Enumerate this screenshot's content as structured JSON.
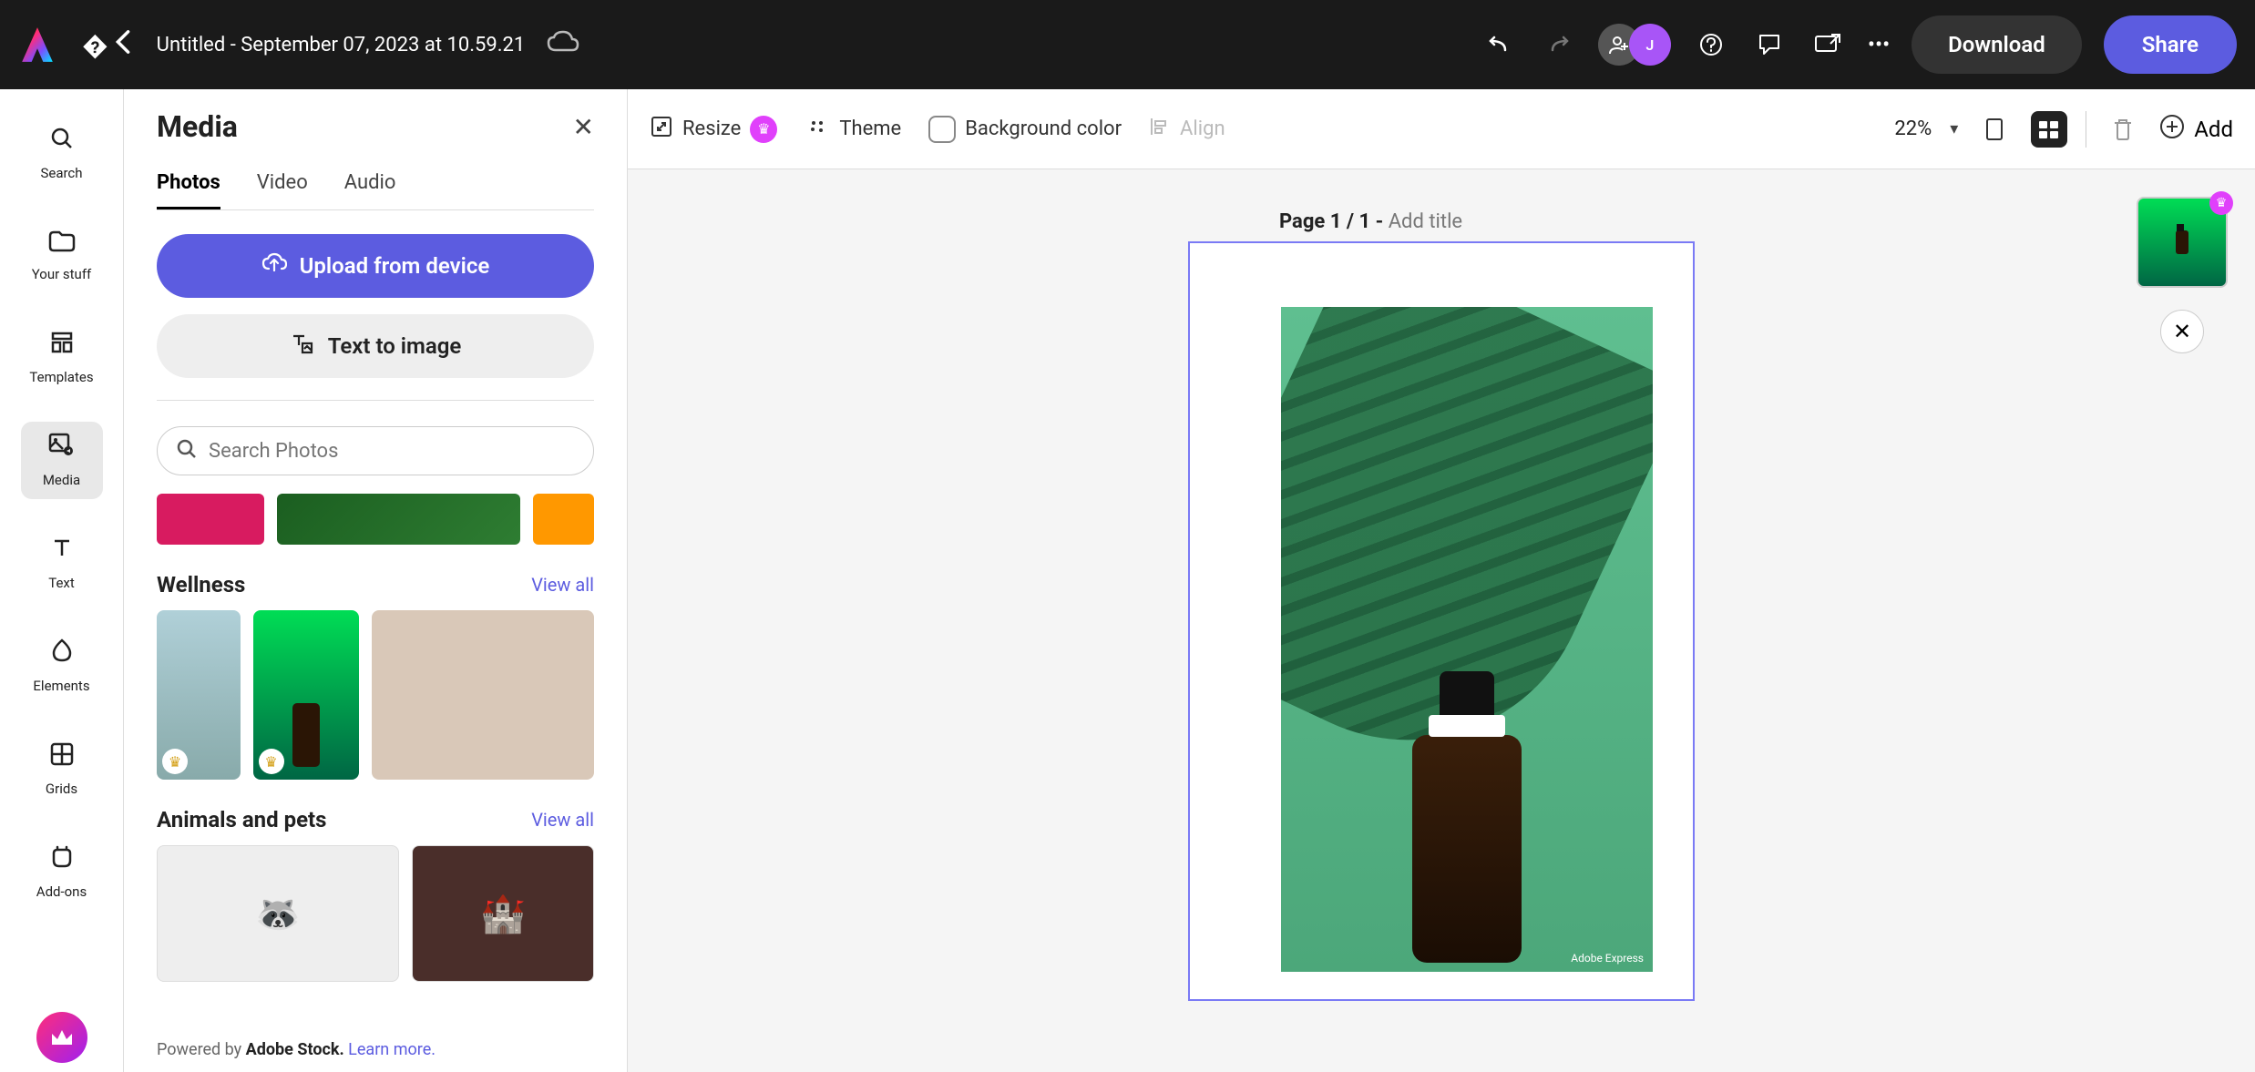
{
  "document": {
    "title": "Untitled - September 07, 2023 at 10.59.21"
  },
  "topbar": {
    "download_label": "Download",
    "share_label": "Share",
    "avatar_initial": "J"
  },
  "rail": {
    "items": [
      {
        "label": "Search"
      },
      {
        "label": "Your stuff"
      },
      {
        "label": "Templates"
      },
      {
        "label": "Media"
      },
      {
        "label": "Text"
      },
      {
        "label": "Elements"
      },
      {
        "label": "Grids"
      },
      {
        "label": "Add-ons"
      }
    ]
  },
  "panel": {
    "title": "Media",
    "tabs": {
      "photos": "Photos",
      "video": "Video",
      "audio": "Audio"
    },
    "upload_label": "Upload from device",
    "t2i_label": "Text to image",
    "search_placeholder": "Search Photos",
    "sections": {
      "wellness": {
        "title": "Wellness",
        "viewall": "View all"
      },
      "pets": {
        "title": "Animals and pets",
        "viewall": "View all"
      }
    },
    "footer": {
      "prefix": "Powered by ",
      "brand": "Adobe Stock.",
      "link": "Learn more."
    }
  },
  "toolbar": {
    "resize": "Resize",
    "theme": "Theme",
    "bgcolor": "Background color",
    "align": "Align",
    "zoom": "22%",
    "add": "Add"
  },
  "page": {
    "label_prefix": "Page 1 / 1 - ",
    "label_placeholder": "Add title",
    "watermark": "Adobe Express"
  }
}
